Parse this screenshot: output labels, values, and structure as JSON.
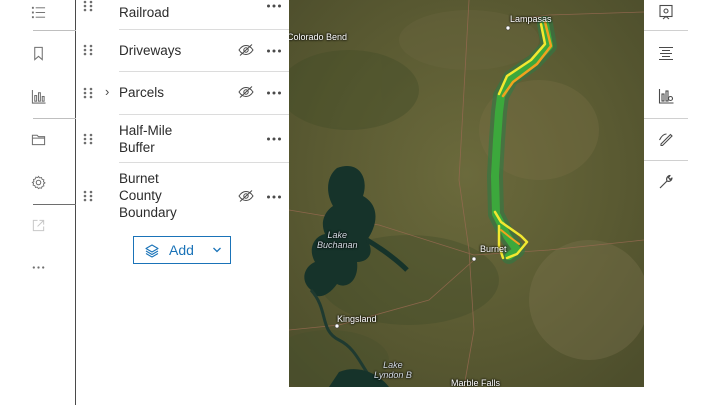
{
  "layers": [
    {
      "label": "Railroad",
      "has_visibility_toggle": false,
      "expandable": false
    },
    {
      "label": "Driveways",
      "has_visibility_toggle": true,
      "expandable": false
    },
    {
      "label": "Parcels",
      "has_visibility_toggle": true,
      "expandable": true
    },
    {
      "label": "Half-Mile\nBuffer",
      "has_visibility_toggle": false,
      "expandable": false
    },
    {
      "label": "Burnet\nCounty\nBoundary",
      "has_visibility_toggle": true,
      "expandable": false
    }
  ],
  "add_button": {
    "label": "Add"
  },
  "map": {
    "labels": {
      "lampasas": "Lampasas",
      "colorado_bend": "Colorado Bend",
      "lake_buchanan": "Lake\nBuchanan",
      "burnet": "Burnet",
      "kingsland": "Kingsland",
      "lake_lyndon_b": "Lake\nLyndon B",
      "marble_falls": "Marble Falls"
    },
    "colors": {
      "route_yellow": "#f2e830",
      "route_green": "#3ca83c",
      "route_orange": "#f0a21e",
      "water": "#16332a"
    }
  },
  "action_bar_icons": [
    "list-icon",
    "bookmark-icon",
    "chart-icon",
    "folder-icon",
    "gear-icon",
    "share-icon",
    "more-icon"
  ],
  "tool_bar_icons": [
    "map-settings-icon",
    "legend-icon",
    "analysis-icon",
    "sketch-icon",
    "wrench-icon"
  ],
  "accent_color": "#1a73b8"
}
